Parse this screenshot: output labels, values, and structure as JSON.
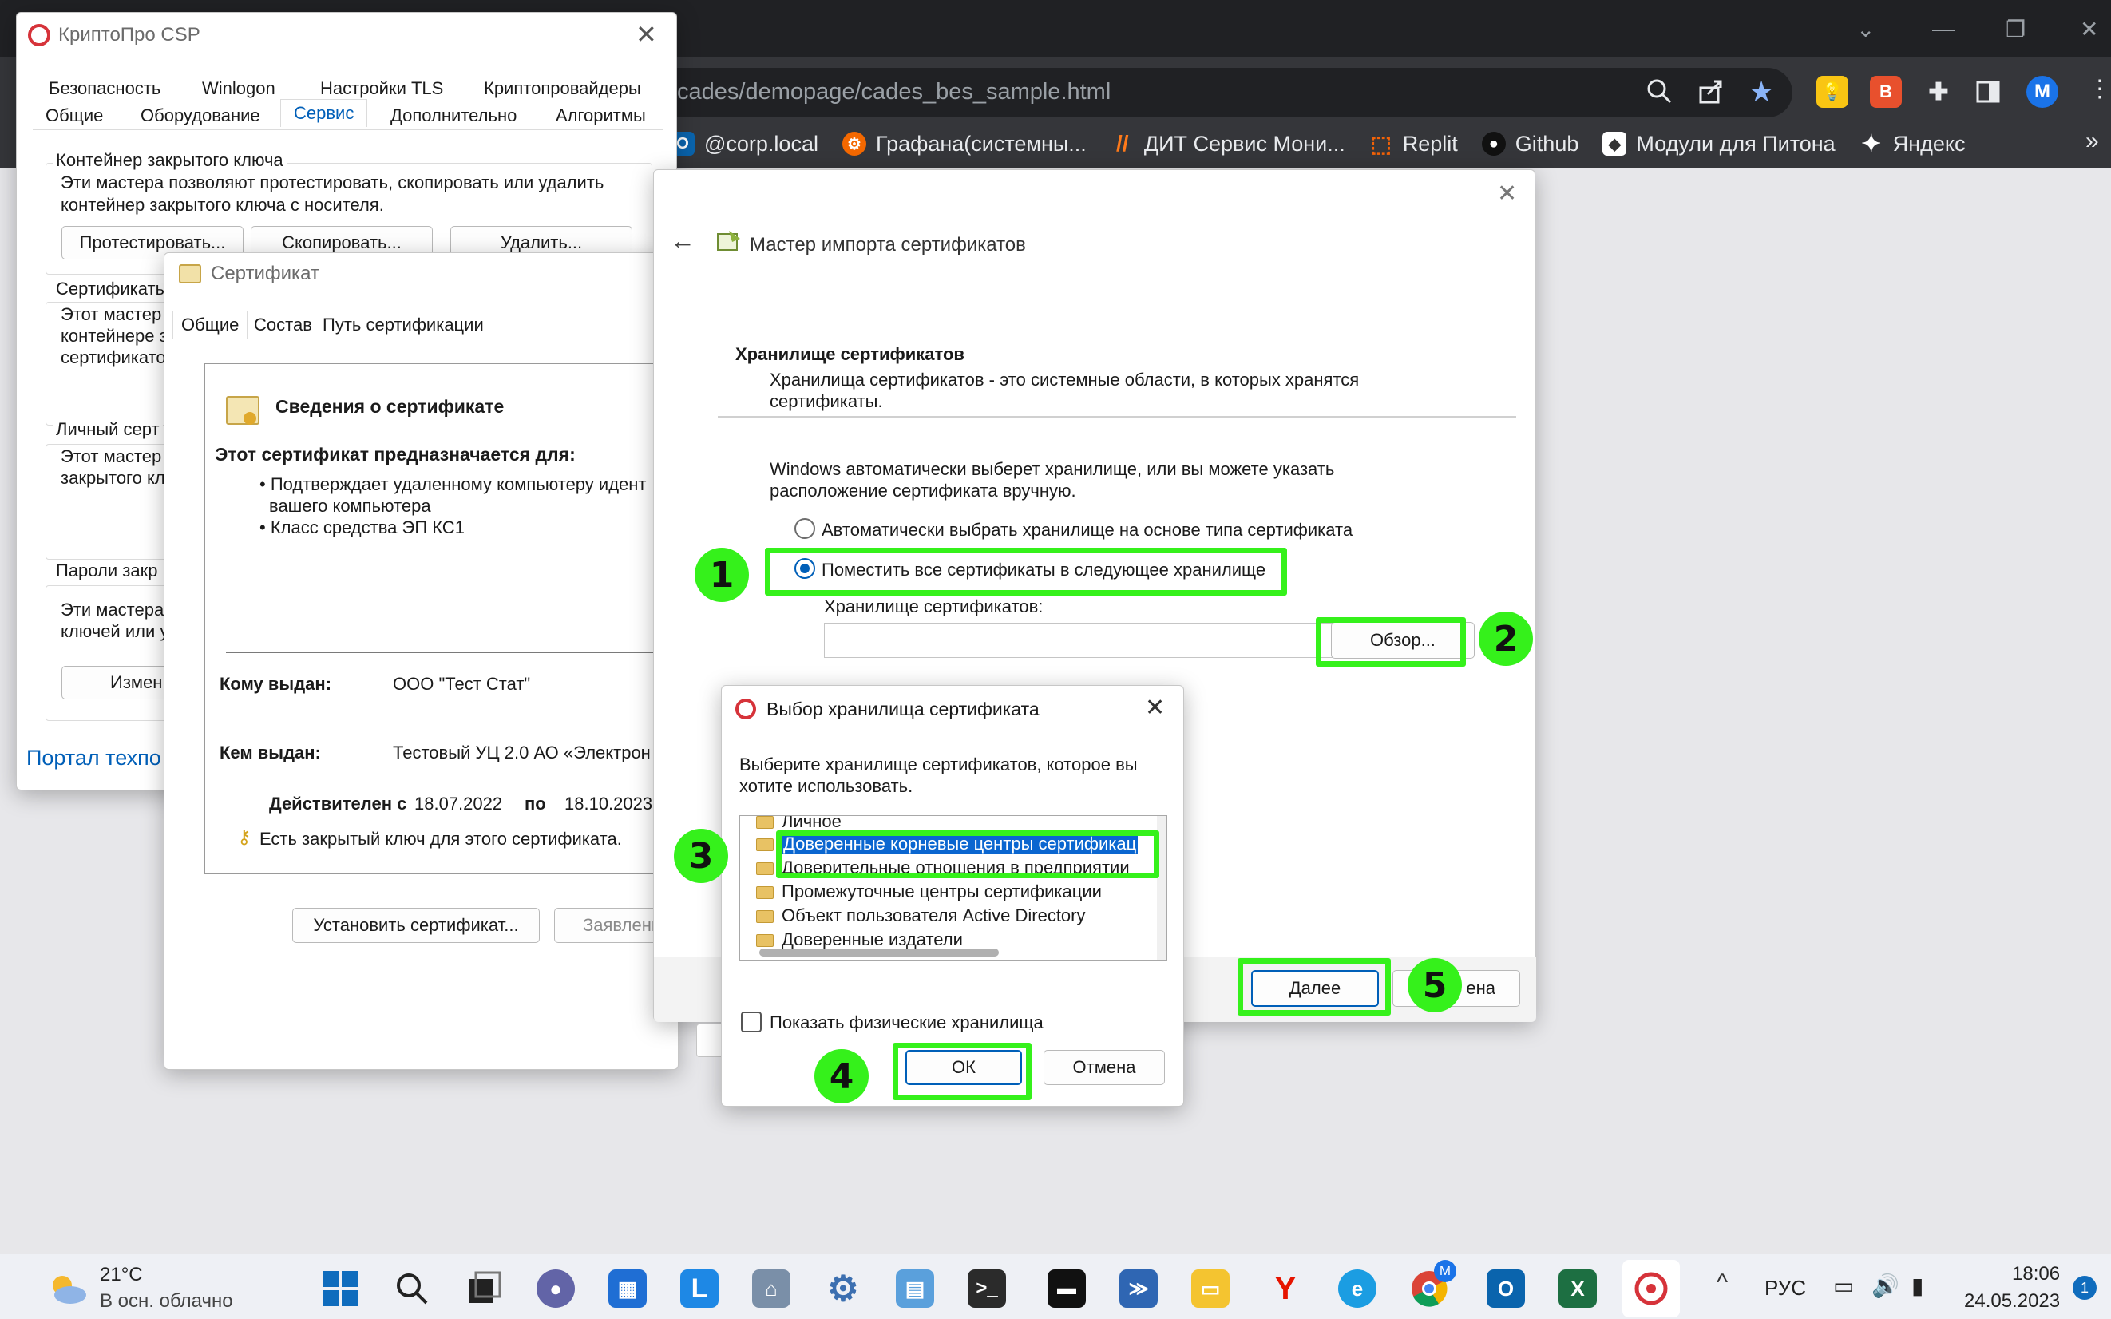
{
  "browser": {
    "url": "cades/demopage/cades_bes_sample.html",
    "profile_letter": "M",
    "bookmarks": [
      {
        "label": "@corp.local",
        "icon": "outlook-icon",
        "color": "#0a64ad"
      },
      {
        "label": "Графана(системны...",
        "icon": "grafana-icon",
        "color": "#f46800"
      },
      {
        "label": "ДИТ Сервис Мони...",
        "icon": "dit-icon",
        "color": "#ff7a1a"
      },
      {
        "label": "Replit",
        "icon": "replit-icon",
        "color": "#f26207"
      },
      {
        "label": "Github",
        "icon": "github-icon",
        "color": "#111111"
      },
      {
        "label": "Модули для Питона",
        "icon": "cube-icon",
        "color": "#ffffff"
      },
      {
        "label": "Яндекс",
        "icon": "yandex-icon",
        "color": "#000000"
      }
    ],
    "more_bookmarks": "»"
  },
  "cryptopro": {
    "title": "КриптоПро CSP",
    "tabs_row1": [
      "Безопасность",
      "Winlogon",
      "Настройки TLS",
      "Криптопровайдеры"
    ],
    "tabs_row2": [
      "Общие",
      "Оборудование",
      "Сервис",
      "Дополнительно",
      "Алгоритмы"
    ],
    "active_tab": "Сервис",
    "group_container_title": "Контейнер закрытого ключа",
    "group_container_text1": "Эти мастера позволяют протестировать, скопировать или удалить",
    "group_container_text2": "контейнер закрытого ключа с носителя.",
    "btn_test": "Протестировать...",
    "btn_copy": "Скопировать...",
    "btn_delete": "Удалить...",
    "group_certs_title": "Сертификаты",
    "group_certs_lines": [
      "Этот мастер",
      "контейнере з",
      "сертификато"
    ],
    "group_personal_title": "Личный серт",
    "group_personal_lines": [
      "Этот мастер",
      "закрытого кл"
    ],
    "group_pass_title": "Пароли закр",
    "group_pass_lines": [
      "Эти мастера",
      "ключей или у"
    ],
    "btn_change": "Измен",
    "portal_link": "Портал техпо"
  },
  "certificate": {
    "title": "Сертификат",
    "tabs": [
      "Общие",
      "Состав",
      "Путь сертификации"
    ],
    "heading": "Сведения о сертификате",
    "purpose_title": "Этот сертификат предназначается для:",
    "purpose_1a": "• Подтверждает удаленному компьютеру идент",
    "purpose_1b": "вашего компьютера",
    "purpose_2": "• Класс средства ЭП КС1",
    "issued_to_label": "Кому выдан:",
    "issued_to_value": "ООО \"Тест Стат\"",
    "issued_by_label": "Кем выдан:",
    "issued_by_value": "Тестовый УЦ 2.0 АО «Электрон",
    "valid_from_label": "Действителен с",
    "valid_from": "18.07.2022",
    "valid_to_label": "по",
    "valid_to": "18.10.2023",
    "private_key_note": "Есть закрытый ключ для этого сертификата.",
    "btn_install": "Установить сертификат...",
    "btn_statement": "Заявлени"
  },
  "wizard": {
    "title": "Мастер импорта сертификатов",
    "section_title": "Хранилище сертификатов",
    "section_desc1": "Хранилища сертификатов - это системные области, в которых хранятся",
    "section_desc2": "сертификаты.",
    "info1": "Windows автоматически выберет хранилище, или вы можете указать",
    "info2": "расположение сертификата вручную.",
    "radio_auto": "Автоматически выбрать хранилище на основе типа сертификата",
    "radio_manual": "Поместить все сертификаты в следующее хранилище",
    "selected_option": "manual",
    "store_label": "Хранилище сертификатов:",
    "store_value": "",
    "btn_browse": "Обзор...",
    "btn_next": "Далее",
    "btn_cancel_partial": "ена"
  },
  "store_dialog": {
    "title": "Выбор хранилища сертификата",
    "desc1": "Выберите хранилище сертификатов, которое вы",
    "desc2": "хотите использовать.",
    "items": [
      "Личное",
      "Доверенные корневые центры сертификац",
      "Доверительные отношения в предприятии",
      "Промежуточные центры сертификации",
      "Объект пользователя Active Directory",
      "Доверенные издатели"
    ],
    "selected_index": 1,
    "show_physical": "Показать физические хранилища",
    "show_physical_checked": false,
    "btn_ok": "ОК",
    "btn_cancel": "Отмена"
  },
  "markers": [
    "1",
    "2",
    "3",
    "4",
    "5"
  ],
  "highlight_color": "#35f11b",
  "taskbar": {
    "weather_temp": "21°C",
    "weather_desc": "В осн. облачно",
    "lang": "РУС",
    "time": "18:06",
    "date": "24.05.2023",
    "notifications": "1",
    "chrome_badge": "M"
  }
}
